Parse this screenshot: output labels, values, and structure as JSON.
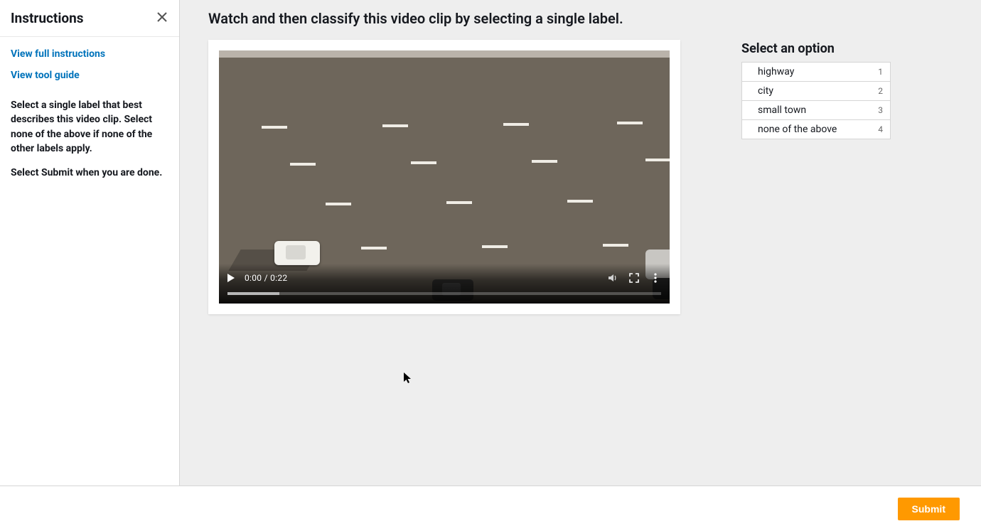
{
  "sidebar": {
    "title": "Instructions",
    "link_full": "View full instructions",
    "link_guide": "View tool guide",
    "para1": "Select a single label that best describes this video clip. Select none of the above if none of the other labels apply.",
    "para2": "Select Submit when you are done."
  },
  "main": {
    "task_title": "Watch and then classify this video clip by selecting a single label.",
    "video": {
      "time": "0:00 / 0:22"
    }
  },
  "options": {
    "title": "Select an option",
    "items": [
      {
        "label": "highway",
        "shortcut": "1"
      },
      {
        "label": "city",
        "shortcut": "2"
      },
      {
        "label": "small town",
        "shortcut": "3"
      },
      {
        "label": "none of the above",
        "shortcut": "4"
      }
    ]
  },
  "footer": {
    "submit": "Submit"
  }
}
